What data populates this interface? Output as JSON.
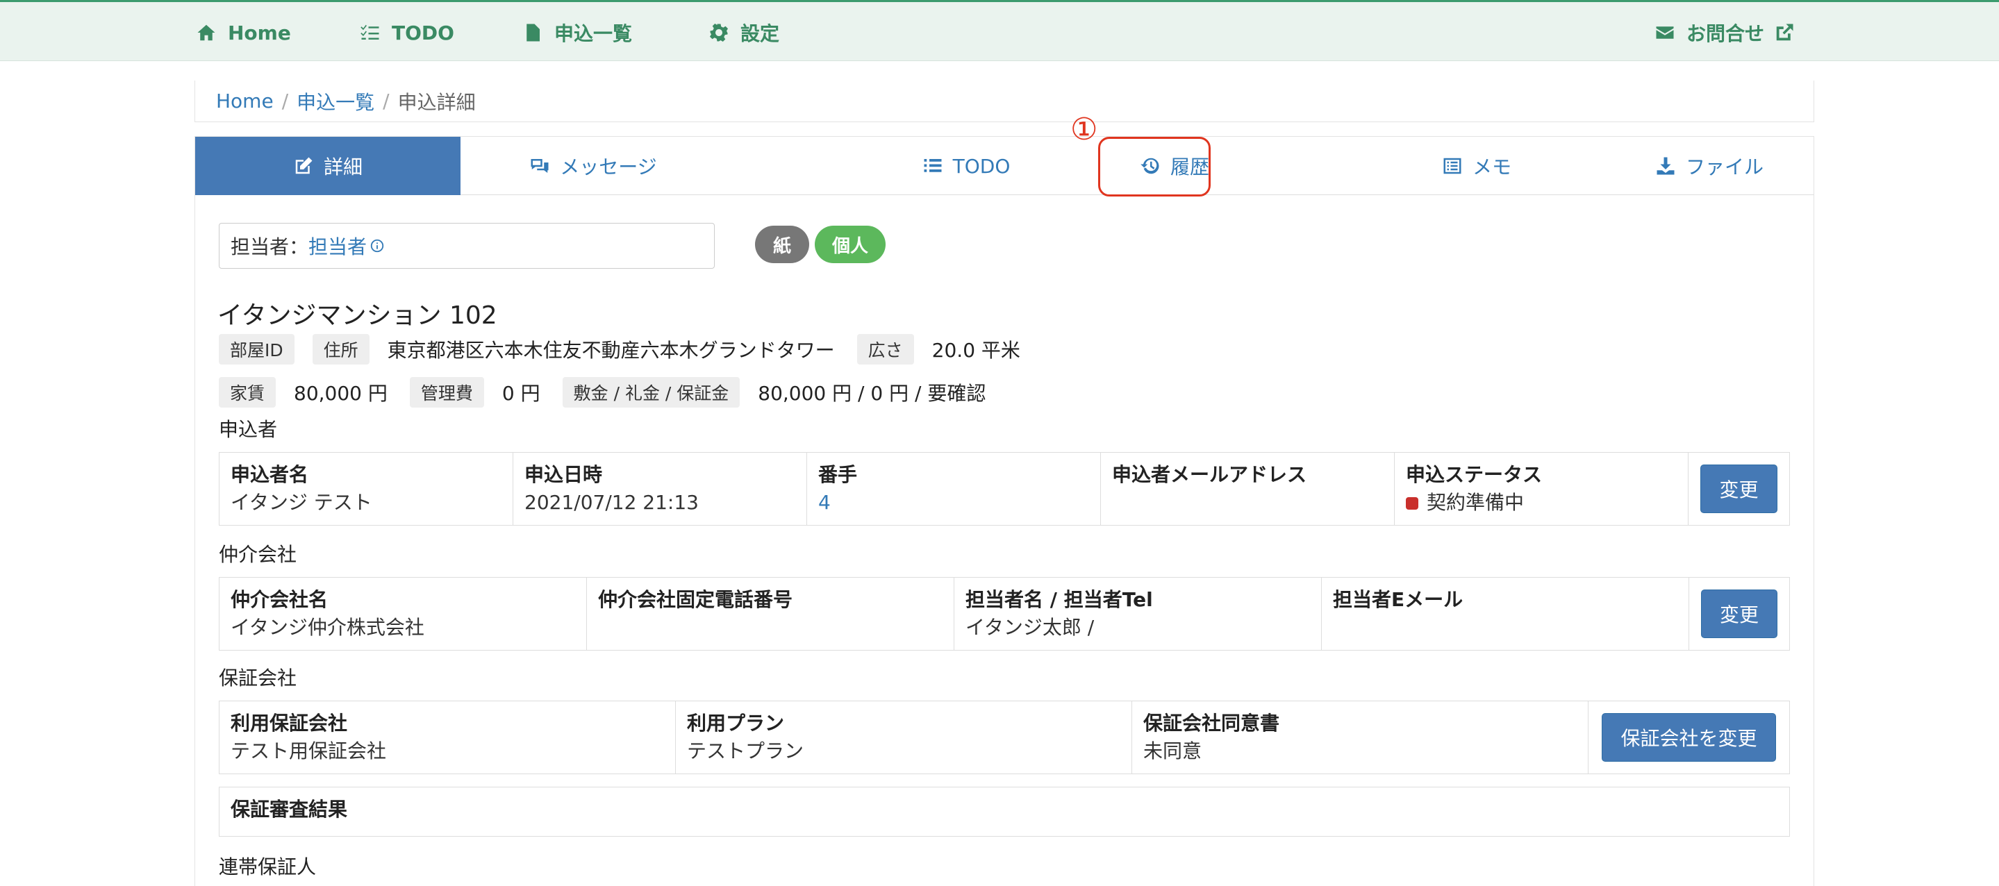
{
  "nav": {
    "home": "Home",
    "todo": "TODO",
    "applications": "申込一覧",
    "settings": "設定",
    "contact": "お問合せ"
  },
  "breadcrumb": {
    "home": "Home",
    "list": "申込一覧",
    "current": "申込詳細"
  },
  "tabs": {
    "detail": "詳細",
    "message": "メッセージ",
    "todo": "TODO",
    "history": "履歴",
    "memo": "メモ",
    "file": "ファイル"
  },
  "annotation": {
    "number": "①"
  },
  "assignee": {
    "label": "担当者：",
    "value": "担当者"
  },
  "badges": {
    "paper": "紙",
    "person": "個人"
  },
  "room": {
    "title": "イタンジマンション 102",
    "room_id_label": "部屋ID",
    "address_label": "住所",
    "address": "東京都港区六本木住友不動産六本木グランドタワー",
    "area_label": "広さ",
    "area": "20.0 平米",
    "rent_label": "家賃",
    "rent": "80,000 円",
    "fee_label": "管理費",
    "fee": "0 円",
    "deposit_label": "敷金 / 礼金 / 保証金",
    "deposit": "80,000 円 / 0 円 / 要確認"
  },
  "applicant": {
    "section": "申込者",
    "name_h": "申込者名",
    "name": "イタンジ テスト",
    "date_h": "申込日時",
    "date": "2021/07/12 21:13",
    "order_h": "番手",
    "order": "4",
    "email_h": "申込者メールアドレス",
    "email": "",
    "status_h": "申込ステータス",
    "status": "契約準備中",
    "button": "変更",
    "status_color": "#c9302c"
  },
  "agency": {
    "section": "仲介会社",
    "name_h": "仲介会社名",
    "name": "イタンジ仲介株式会社",
    "phone_h": "仲介会社固定電話番号",
    "phone": "",
    "staff_h": "担当者名 / 担当者Tel",
    "staff": "イタンジ太郎 /",
    "email_h": "担当者Eメール",
    "email": "",
    "button": "変更"
  },
  "guarantor": {
    "section": "保証会社",
    "company_h": "利用保証会社",
    "company": "テスト用保証会社",
    "plan_h": "利用プラン",
    "plan": "テストプラン",
    "consent_h": "保証会社同意書",
    "consent": "未同意",
    "button": "保証会社を変更"
  },
  "review": {
    "title": "保証審査結果"
  },
  "joint": {
    "section": "連帯保証人"
  },
  "colors": {
    "accent": "#4579b5",
    "nav_green": "#3a8a63",
    "highlight": "#e0351f"
  }
}
